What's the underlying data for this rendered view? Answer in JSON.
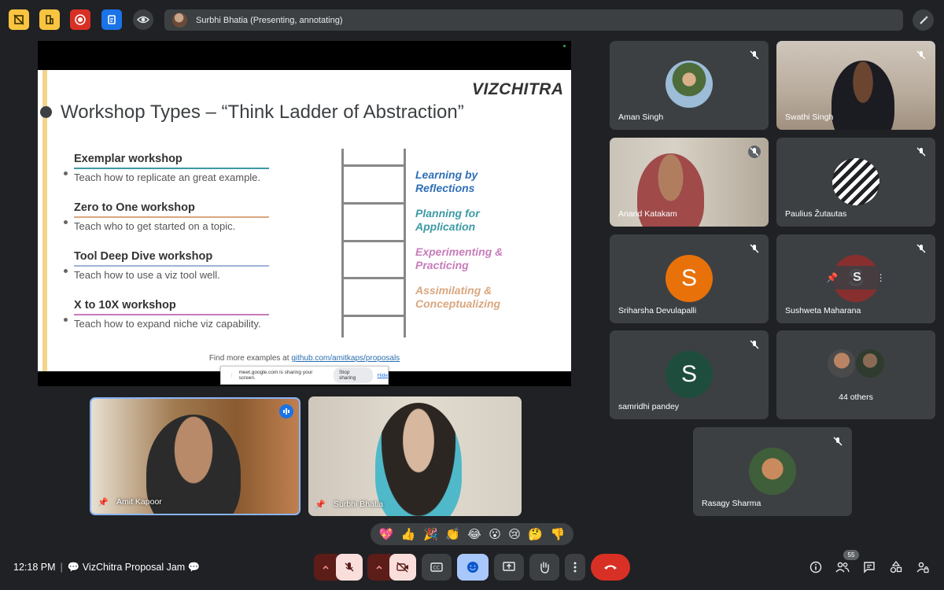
{
  "top_bar": {
    "presenter_text": "Surbhi Bhatia (Presenting, annotating)"
  },
  "slide": {
    "logo": "VIZCHITRA",
    "title": "Workshop Types – “Think Ladder of Abstraction”",
    "workshops": [
      {
        "heading": "Exemplar workshop",
        "description": "Teach how to replicate an great example.",
        "color": "#3c9aa5"
      },
      {
        "heading": "Zero to One workshop",
        "description": "Teach who to get started on a topic.",
        "color": "#d9a77f"
      },
      {
        "heading": "Tool Deep Dive workshop",
        "description": "Teach how to use a viz tool well.",
        "color": "#9fb3d6"
      },
      {
        "heading": "X to 10X workshop",
        "description": "Teach how to expand niche viz capability.",
        "color": "#c77cba"
      }
    ],
    "levels": [
      {
        "text": "Learning by\nReflections",
        "color": "#2f6fb7"
      },
      {
        "text": "Planning for\nApplication",
        "color": "#3c9aa5"
      },
      {
        "text": "Experimenting &\nPracticing",
        "color": "#c77cba"
      },
      {
        "text": "Assimilating &\nConceptualizing",
        "color": "#d9a77f"
      }
    ],
    "footer_prefix": "Find more examples at ",
    "footer_link": "github.com/amitkaps/proposals"
  },
  "share_popup": {
    "message": "meet.google.com is sharing your screen.",
    "stop_label": "Stop sharing",
    "hide_label": "Hide"
  },
  "participants": [
    {
      "name": "Aman Singh"
    },
    {
      "name": "Swathi Singh"
    },
    {
      "name": "Anand Katakam"
    },
    {
      "name": "Paulius Žutautas"
    },
    {
      "name": "Sriharsha Devulapalli",
      "initial": "S",
      "color": "#e8710a"
    },
    {
      "name": "Sushweta Maharana",
      "initial": "S",
      "color": "#c5221f"
    },
    {
      "name": "samridhi pandey",
      "initial": "S",
      "color": "#1e4d3d"
    },
    {
      "name": "44 others"
    },
    {
      "name": "Rasagy Sharma"
    }
  ],
  "main_videos": {
    "amit": "Amit Kapoor",
    "surbhi": "Surbhi Bhatia"
  },
  "reactions": [
    "💖",
    "👍",
    "🎉",
    "👏",
    "😂",
    "😮",
    "😢",
    "🤔",
    "👎"
  ],
  "bottom_bar": {
    "time": "12:18 PM",
    "meeting_name": "💬 VizChitra Proposal Jam 💬",
    "participant_count": "55"
  }
}
